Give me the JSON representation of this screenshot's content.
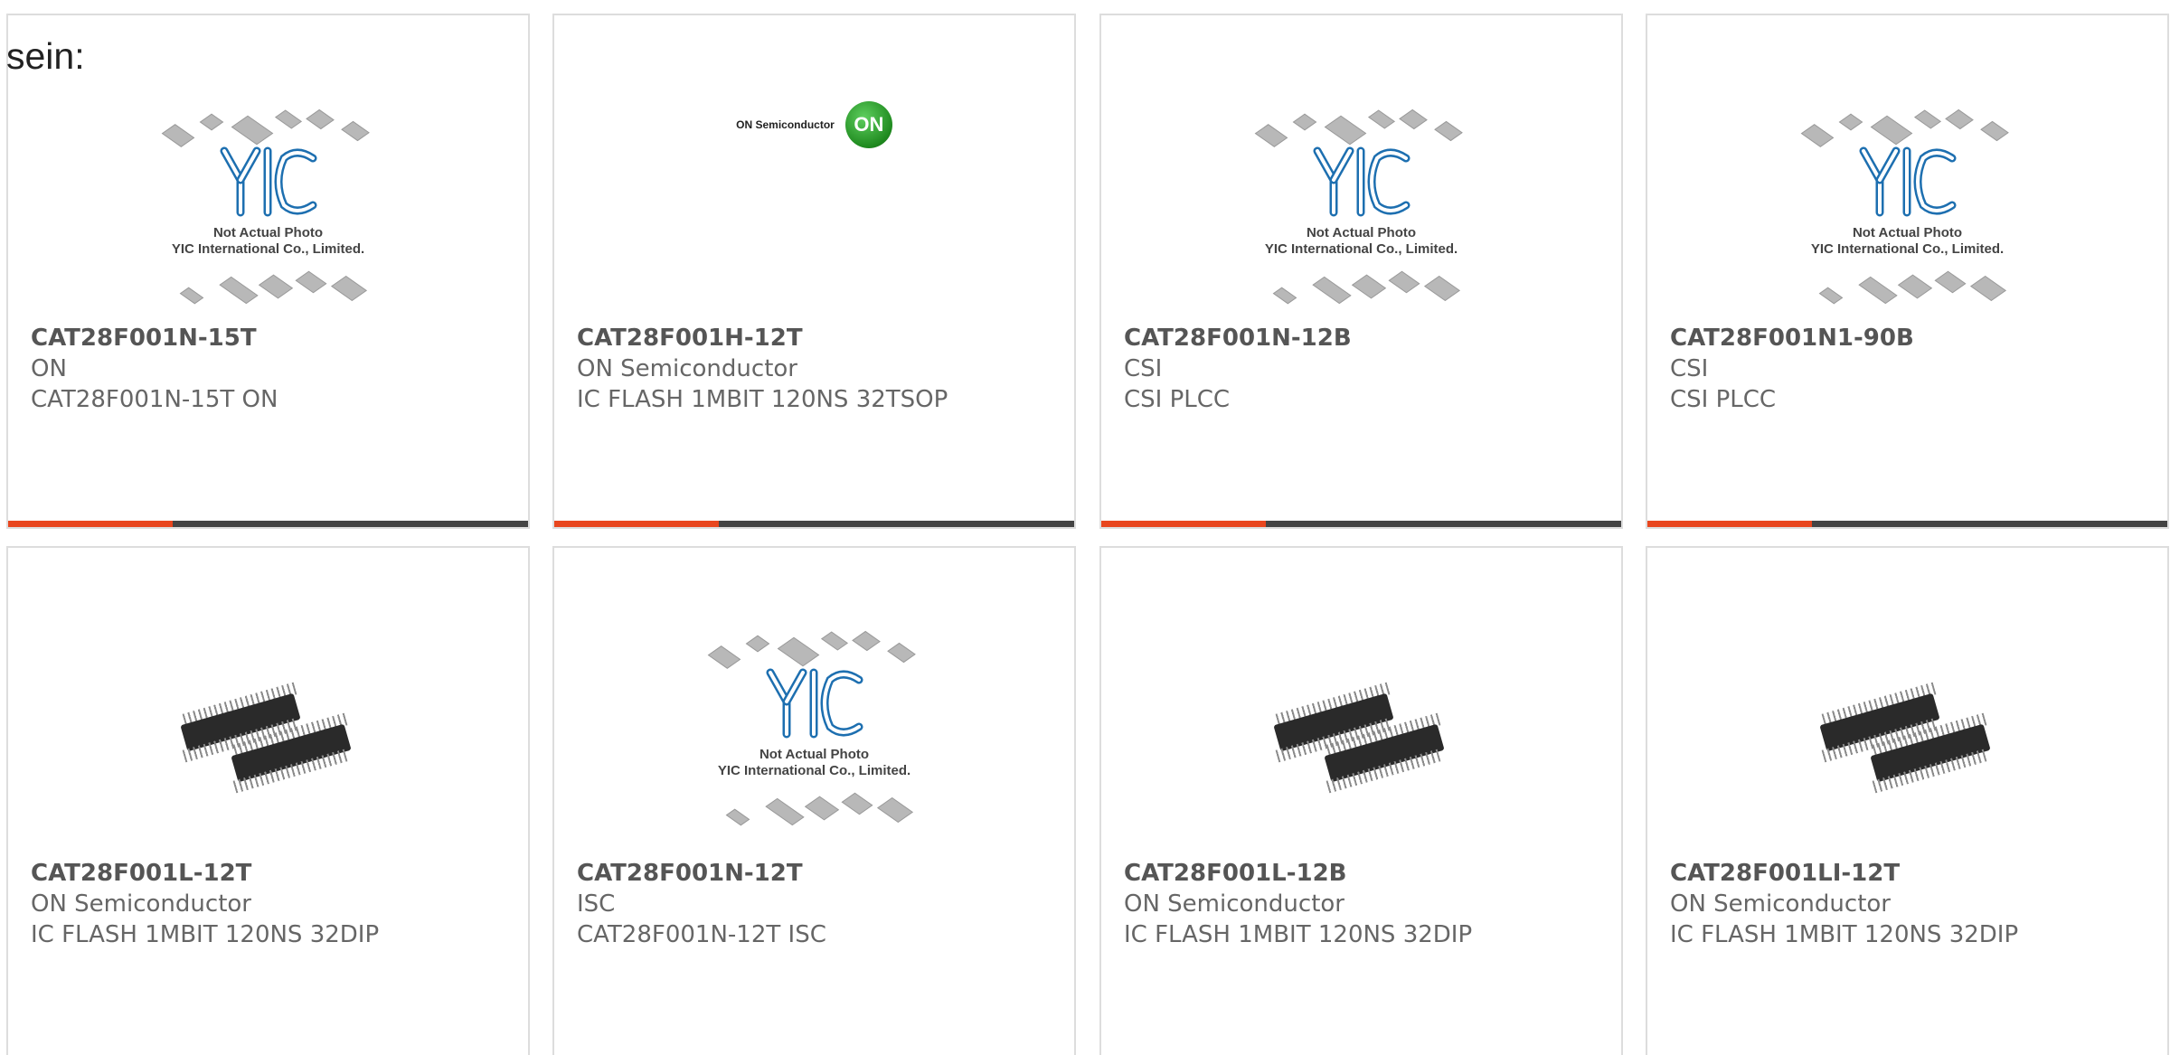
{
  "intro_text": "sein:",
  "accent_color": "#e8461e",
  "placeholder": {
    "line1": "Not Actual Photo",
    "line2": "YIC International Co., Limited."
  },
  "brand_logo": {
    "text": "ON Semiconductor",
    "mark": "ON"
  },
  "products": [
    {
      "part": "CAT28F001N-15T",
      "manufacturer": "ON",
      "description": "CAT28F001N-15T ON",
      "image": "yic-placeholder"
    },
    {
      "part": "CAT28F001H-12T",
      "manufacturer": "ON Semiconductor",
      "description": "IC FLASH 1MBIT 120NS 32TSOP",
      "image": "on-semiconductor-logo"
    },
    {
      "part": "CAT28F001N-12B",
      "manufacturer": "CSI",
      "description": "CSI PLCC",
      "image": "yic-placeholder"
    },
    {
      "part": "CAT28F001N1-90B",
      "manufacturer": "CSI",
      "description": "CSI PLCC",
      "image": "yic-placeholder"
    },
    {
      "part": "CAT28F001L-12T",
      "manufacturer": "ON Semiconductor",
      "description": "IC FLASH 1MBIT 120NS 32DIP",
      "image": "dip-chip-photo"
    },
    {
      "part": "CAT28F001N-12T",
      "manufacturer": "ISC",
      "description": "CAT28F001N-12T ISC",
      "image": "yic-placeholder"
    },
    {
      "part": "CAT28F001L-12B",
      "manufacturer": "ON Semiconductor",
      "description": "IC FLASH 1MBIT 120NS 32DIP",
      "image": "dip-chip-photo"
    },
    {
      "part": "CAT28F001LI-12T",
      "manufacturer": "ON Semiconductor",
      "description": "IC FLASH 1MBIT 120NS 32DIP",
      "image": "dip-chip-photo"
    }
  ]
}
